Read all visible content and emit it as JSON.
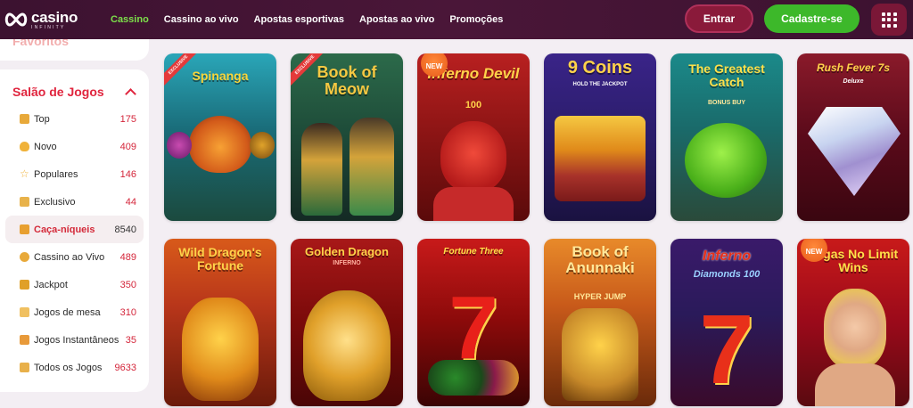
{
  "header": {
    "logo_main": "casino",
    "logo_sub": "INFINITY",
    "nav": [
      "Cassino",
      "Cassino ao vivo",
      "Apostas esportivas",
      "Apostas ao vivo",
      "Promoções"
    ],
    "login_label": "Entrar",
    "register_label": "Cadastre-se"
  },
  "sidebar": {
    "prev_section": "Favoritos",
    "title": "Salão de Jogos",
    "items": [
      {
        "label": "Top",
        "count": "175"
      },
      {
        "label": "Novo",
        "count": "409"
      },
      {
        "label": "Populares",
        "count": "146"
      },
      {
        "label": "Exclusivo",
        "count": "44"
      },
      {
        "label": "Caça-níqueis",
        "count": "8540"
      },
      {
        "label": "Cassino ao Vivo",
        "count": "489"
      },
      {
        "label": "Jackpot",
        "count": "350"
      },
      {
        "label": "Jogos de mesa",
        "count": "310"
      },
      {
        "label": "Jogos Instantâneos",
        "count": "35"
      },
      {
        "label": "Todos os Jogos",
        "count": "9633"
      }
    ]
  },
  "games": [
    {
      "title": "Spinanga",
      "badge": "EXCLUSIVE"
    },
    {
      "title": "Book of Meow",
      "badge": "EXCLUSIVE"
    },
    {
      "title": "Inferno Devil",
      "sub": "100",
      "badge": "NEW"
    },
    {
      "title": "9 Coins",
      "sub": "HOLD THE JACKPOT"
    },
    {
      "title": "The Greatest Catch",
      "sub": "BONUS BUY"
    },
    {
      "title": "Rush Fever 7s",
      "sub": "Deluxe"
    },
    {
      "title": "Wild Dragon's Fortune"
    },
    {
      "title": "Golden Dragon",
      "sub": "INFERNO"
    },
    {
      "title": "Fortune Three"
    },
    {
      "title": "Book of Anunnaki",
      "sub": "HYPER JUMP"
    },
    {
      "title": "Inferno",
      "sub": "Diamonds 100"
    },
    {
      "title": "Vegas No Limit Wins",
      "badge": "NEW"
    }
  ],
  "colors": {
    "header_bg": "#4a1638",
    "nav_active": "#7ce04a",
    "accent_red": "#e0253e",
    "register_green": "#3db82a"
  }
}
